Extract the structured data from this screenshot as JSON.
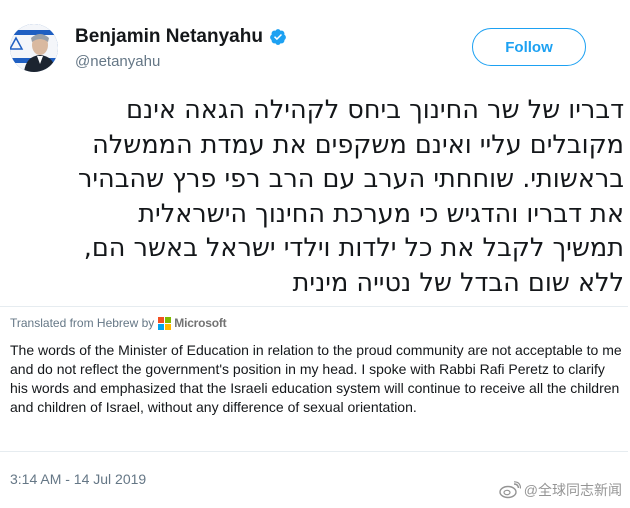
{
  "author": {
    "display_name": "Benjamin Netanyahu",
    "handle": "@netanyahu",
    "verified": true,
    "avatar_icon": "profile-photo-with-israeli-flag"
  },
  "follow_button": {
    "label": "Follow"
  },
  "tweet": {
    "lines": [
      "דבריו של שר החינוך ביחס לקהילה הגאה אינם",
      "מקובלים עליי ואינם משקפים את עמדת הממשלה",
      "בראשותי. שוחחתי הערב עם הרב רפי פרץ שהבהיר",
      "את דבריו והדגיש כי מערכת החינוך הישראלית",
      "תמשיך לקבל את כל ילדות וילדי ישראל באשר הם,",
      "ללא שום הבדל של נטייה מינית"
    ]
  },
  "translation": {
    "label": "Translated from Hebrew by",
    "provider": "Microsoft",
    "text": "The words of the Minister of Education in relation to the proud community are not acceptable to me and do not reflect the government's position in my head. I spoke with Rabbi Rafi Peretz to clarify his words and emphasized that the Israeli education system will continue to receive all the children and children of Israel, without any difference of sexual orientation."
  },
  "timestamp": "3:14 AM - 14 Jul 2019",
  "watermark": {
    "icon": "weibo-icon",
    "text": "@全球同志新闻"
  },
  "colors": {
    "twitter_blue": "#1da1f2",
    "secondary_text": "#657786",
    "primary_text": "#14171a",
    "divider": "#e6ecf0"
  }
}
